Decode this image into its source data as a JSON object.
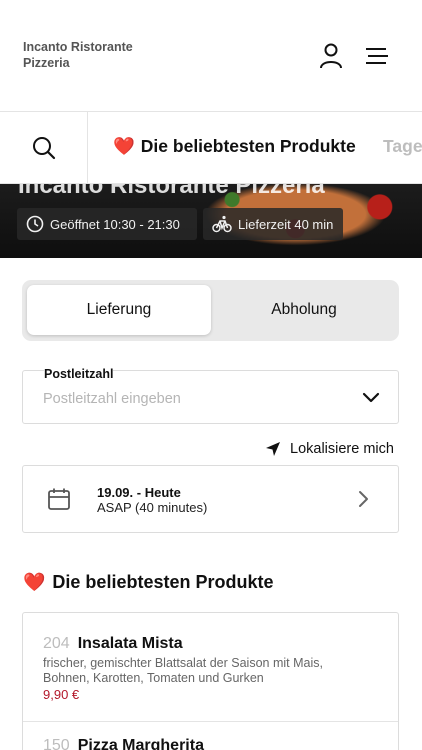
{
  "header": {
    "brand_line1": "Incanto Ristorante",
    "brand_line2": "Pizzeria"
  },
  "hero": {
    "title": "Incanto Ristorante Pizzeria",
    "open_text": "Geöffnet 10:30 - 21:30",
    "delivery_time_text": "Lieferzeit 40 min"
  },
  "categories": {
    "active": {
      "emoji": "❤️",
      "label": "Die beliebtesten Produkte"
    },
    "next": {
      "label": "Tage"
    }
  },
  "order_mode": {
    "delivery_label": "Lieferung",
    "pickup_label": "Abholung",
    "selected": "Lieferung"
  },
  "postcode": {
    "label": "Postleitzahl",
    "placeholder": "Postleitzahl eingeben",
    "value": ""
  },
  "locate": {
    "label": "Lokalisiere mich"
  },
  "schedule": {
    "date": "19.09. - Heute",
    "time": "ASAP (40 minutes)"
  },
  "section": {
    "emoji": "❤️",
    "title": "Die beliebtesten Produkte"
  },
  "products": [
    {
      "number": "204",
      "name": "Insalata Mista",
      "description": "frischer, gemischter Blattsalat der Saison mit Mais, Bohnen, Karotten, Tomaten und Gurken",
      "price": "9,90 €"
    },
    {
      "number": "150",
      "name": "Pizza Margherita"
    }
  ],
  "colors": {
    "accent_price": "#b3172a",
    "muted": "#bdbdbd"
  }
}
